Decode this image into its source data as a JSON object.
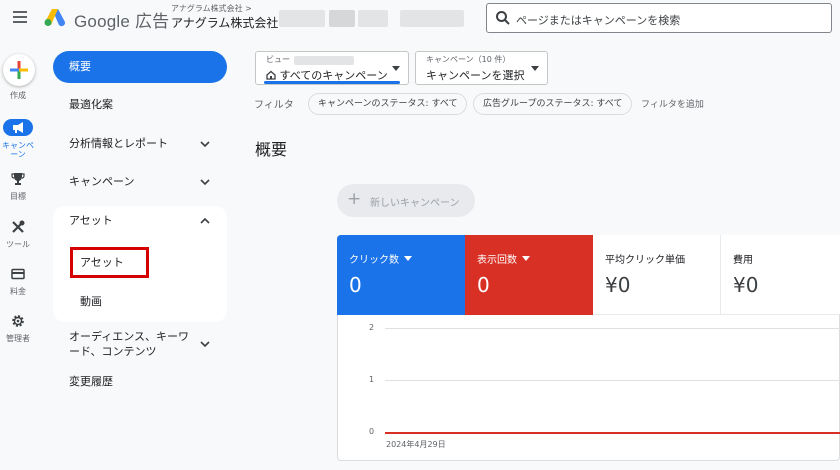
{
  "header": {
    "brand": "Google 広告",
    "account_top": "アナグラム株式会社 >",
    "account_main": "アナグラム株式会社",
    "search_placeholder": "ページまたはキャンペーンを検索"
  },
  "rail": {
    "create": "作成",
    "campaigns": "キャンペーン",
    "goals": "目標",
    "tools": "ツール",
    "billing": "料金",
    "admin": "管理者"
  },
  "nav": {
    "overview": "概要",
    "recommendations": "最適化案",
    "insights": "分析情報とレポート",
    "campaigns": "キャンペーン",
    "assets": "アセット",
    "assets_sub": "アセット",
    "videos_sub": "動画",
    "audiences": "オーディエンス、キーワード、コンテンツ",
    "change_history": "変更履歴"
  },
  "filters": {
    "view_label": "ビュー",
    "view_value": "すべてのキャンペーン",
    "campaign_label": "キャンペーン（10 件）",
    "campaign_value": "キャンペーンを選択",
    "filter_label": "フィルタ",
    "chip1": "キャンペーンのステータス: すべて",
    "chip2": "広告グループのステータス: すべて",
    "add_filter": "フィルタを追加"
  },
  "main": {
    "title": "概要",
    "new_campaign": "新しいキャンペーン"
  },
  "metrics": [
    {
      "label": "クリック数",
      "value": "0",
      "color": "#1a73e8"
    },
    {
      "label": "表示回数",
      "value": "0",
      "color": "#d93025"
    },
    {
      "label": "平均クリック単価",
      "value": "¥0"
    },
    {
      "label": "費用",
      "value": "¥0"
    }
  ],
  "chart_data": {
    "type": "line",
    "yticks": [
      "2",
      "1",
      "0"
    ],
    "ylim": [
      0,
      2
    ],
    "x": [
      "2024年4月29日"
    ],
    "series": [
      {
        "values": [
          0
        ],
        "color": "#d93025"
      }
    ]
  }
}
